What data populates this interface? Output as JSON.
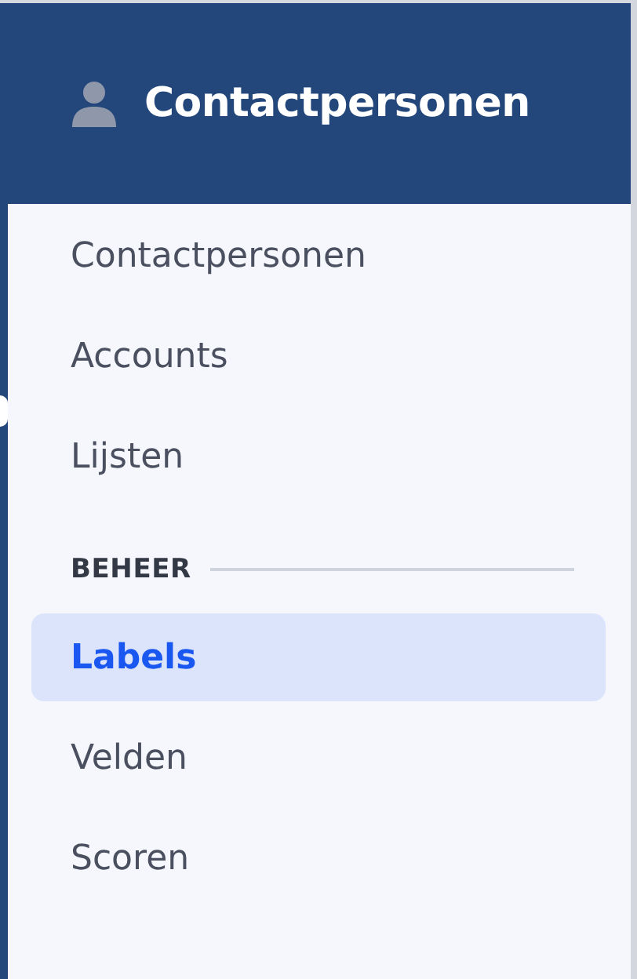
{
  "header": {
    "title": "Contactpersonen"
  },
  "nav": {
    "items": [
      {
        "label": "Contactpersonen",
        "selected": false
      },
      {
        "label": "Accounts",
        "selected": false
      },
      {
        "label": "Lijsten",
        "selected": false
      }
    ]
  },
  "section": {
    "title": "BEHEER",
    "items": [
      {
        "label": "Labels",
        "selected": true
      },
      {
        "label": "Velden",
        "selected": false
      },
      {
        "label": "Scoren",
        "selected": false
      }
    ]
  }
}
